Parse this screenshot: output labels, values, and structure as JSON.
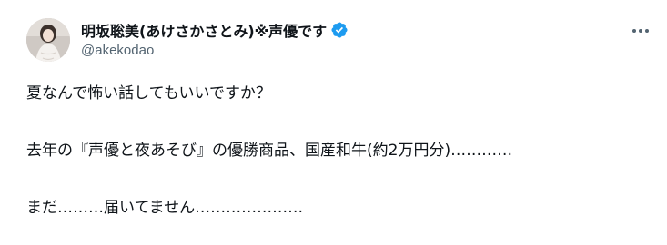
{
  "author": {
    "display_name": "明坂聡美(あけさかさとみ)※声優です",
    "handle": "@akekodao",
    "verified": true
  },
  "icons": {
    "verified": "verified-badge-icon",
    "more": "more-horizontal-icon"
  },
  "colors": {
    "verified_badge": "#1d9bf0",
    "text_primary": "#0f1419",
    "text_secondary": "#536471"
  },
  "tweet": {
    "lines": [
      "夏なんで怖い話してもいいですか？",
      "去年の『声優と夜あそび』の優勝商品、国産和牛(約2万円分)…………",
      "まだ………届いてません…………………"
    ]
  }
}
